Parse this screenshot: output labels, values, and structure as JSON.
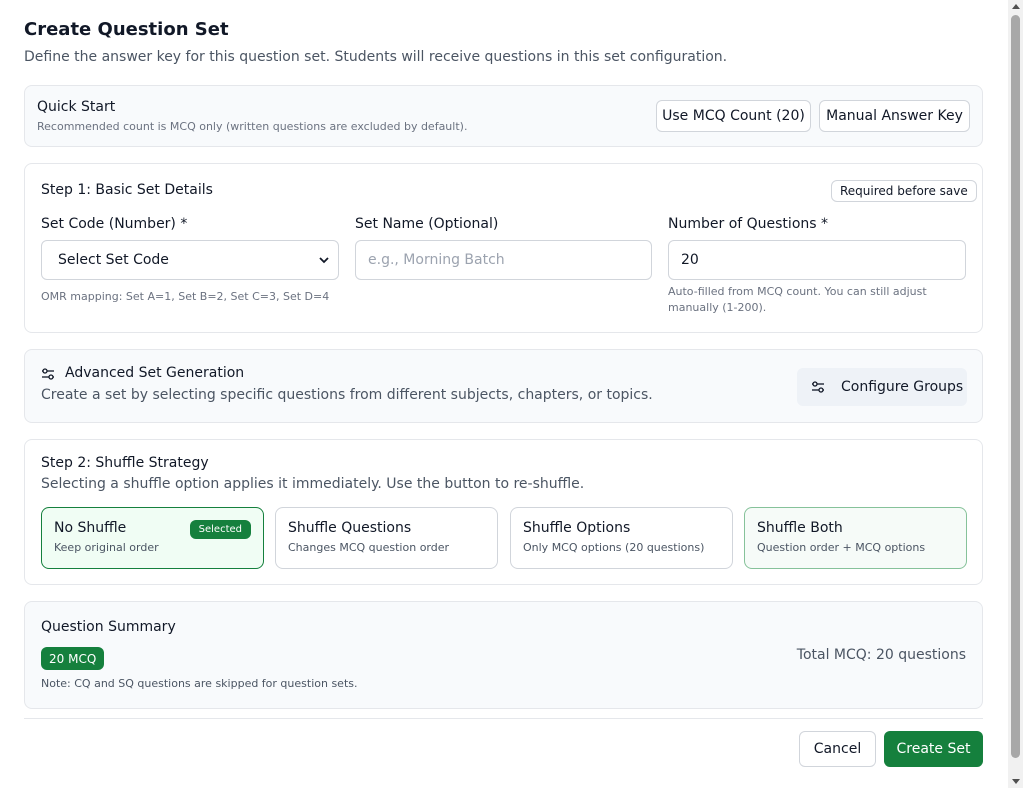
{
  "header": {
    "title": "Create Question Set",
    "subtitle": "Define the answer key for this question set. Students will receive questions in this set configuration."
  },
  "quick_start": {
    "title": "Quick Start",
    "note": "Recommended count is MCQ only (written questions are excluded by default).",
    "use_mcq_button": "Use MCQ Count (20)",
    "manual_key_button": "Manual Answer Key"
  },
  "step1": {
    "title": "Step 1: Basic Set Details",
    "required_badge": "Required before save",
    "set_code": {
      "label": "Set Code (Number) *",
      "value": "Select Set Code",
      "hint": "OMR mapping: Set A=1, Set B=2, Set C=3, Set D=4"
    },
    "set_name": {
      "label": "Set Name (Optional)",
      "placeholder": "e.g., Morning Batch"
    },
    "num_questions": {
      "label": "Number of Questions *",
      "value": "20",
      "hint": "Auto-filled from MCQ count. You can still adjust manually (1-200)."
    }
  },
  "advanced": {
    "title": "Advanced Set Generation",
    "description": "Create a set by selecting specific questions from different subjects, chapters, or topics.",
    "configure_button": "Configure Groups",
    "icon": "sliders-icon"
  },
  "step2": {
    "title": "Step 2: Shuffle Strategy",
    "description": "Selecting a shuffle option applies it immediately. Use the button to re-shuffle.",
    "selected_badge": "Selected",
    "options": [
      {
        "title": "No Shuffle",
        "subtitle": "Keep original order",
        "selected": true
      },
      {
        "title": "Shuffle Questions",
        "subtitle": "Changes MCQ question order",
        "selected": false
      },
      {
        "title": "Shuffle Options",
        "subtitle": "Only MCQ options (20 questions)",
        "selected": false
      },
      {
        "title": "Shuffle Both",
        "subtitle": "Question order + MCQ options",
        "selected": false
      }
    ]
  },
  "summary": {
    "title": "Question Summary",
    "mcq_pill": "20 MCQ",
    "total": "Total MCQ: 20 questions",
    "note": "Note: CQ and SQ questions are skipped for question sets."
  },
  "footer": {
    "cancel_button": "Cancel",
    "create_button": "Create Set"
  },
  "colors": {
    "accent": "#15803d",
    "border": "#e5e7eb",
    "muted_bg": "#f8fafc"
  }
}
